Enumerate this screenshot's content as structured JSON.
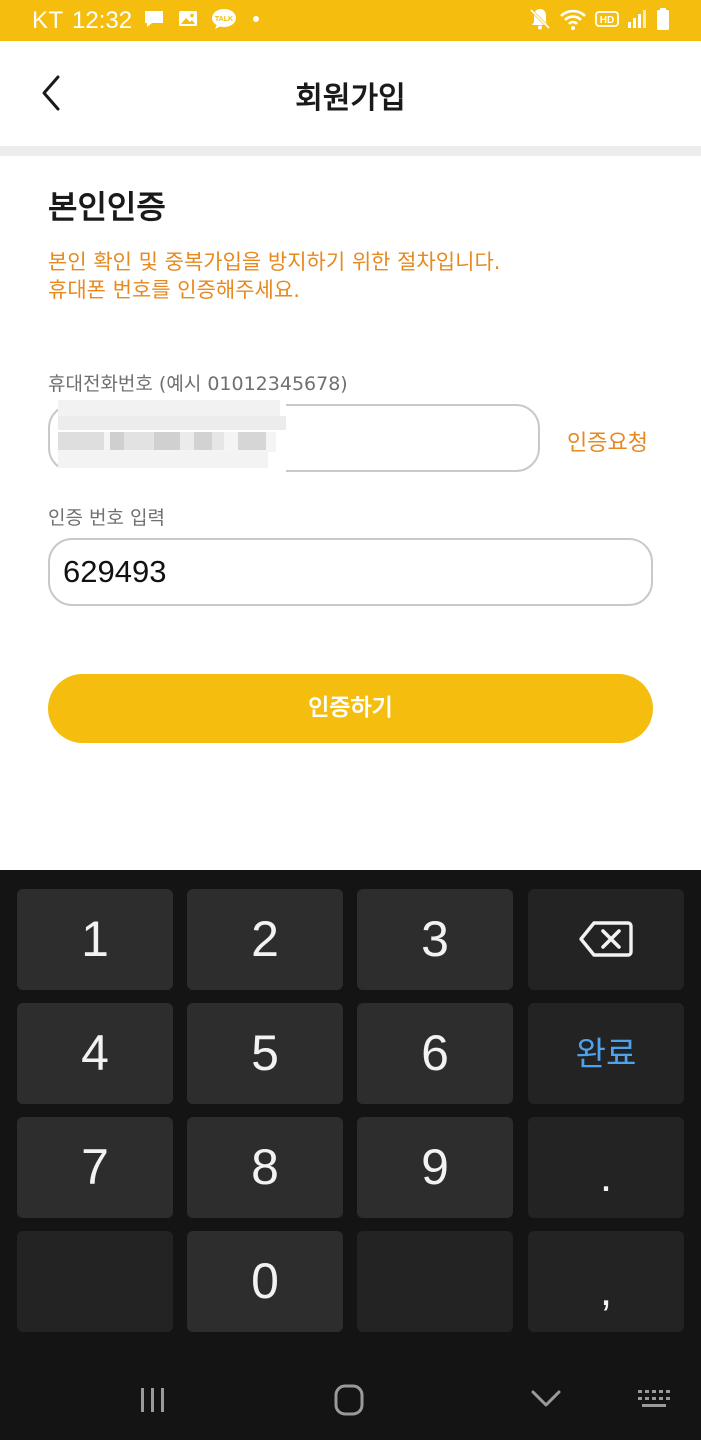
{
  "status_bar": {
    "carrier": "KT",
    "time": "12:32",
    "hd_label": "HD",
    "icons_left": [
      "message-icon",
      "gallery-icon",
      "talk-icon",
      "dot-icon"
    ],
    "icons_right": [
      "mute-icon",
      "wifi-icon",
      "hd-icon",
      "signal-icon",
      "battery-icon"
    ]
  },
  "header": {
    "title": "회원가입"
  },
  "section": {
    "title": "본인인증",
    "notice_line1": "본인 확인 및 중복가입을 방지하기 위한 절차입니다.",
    "notice_line2": "휴대폰 번호를 인증해주세요."
  },
  "phone_field": {
    "label": "휴대전화번호 (예시 01012345678)",
    "value": "",
    "request_label": "인증요청"
  },
  "code_field": {
    "label": "인증 번호 입력",
    "value": "629493"
  },
  "verify_button": {
    "label": "인증하기"
  },
  "keypad": {
    "keys": [
      "1",
      "2",
      "3",
      "4",
      "5",
      "6",
      "7",
      "8",
      "9",
      "0",
      ".",
      ","
    ],
    "done_label": "완료"
  },
  "colors": {
    "accent": "#f5bd0d",
    "notice": "#e8891f",
    "done": "#4da3ee",
    "keypad_bg": "#141414"
  }
}
